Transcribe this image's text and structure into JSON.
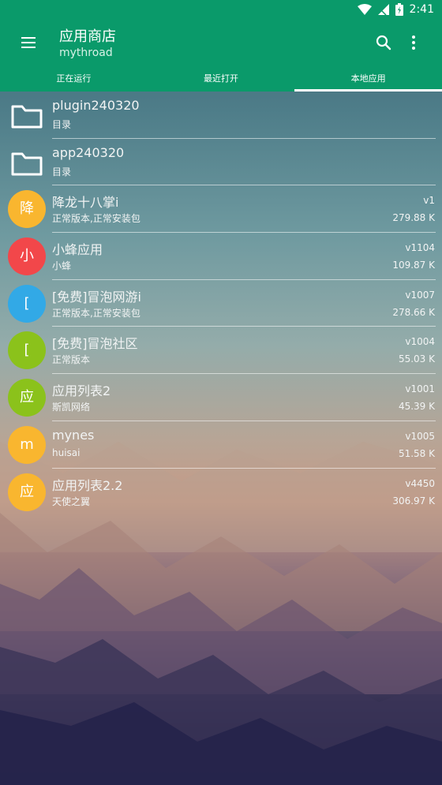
{
  "status_bar": {
    "time": "2:41"
  },
  "header": {
    "title": "应用商店",
    "subtitle": "mythroad"
  },
  "tabs": [
    {
      "label": "正在运行",
      "active": false
    },
    {
      "label": "最近打开",
      "active": false
    },
    {
      "label": "本地应用",
      "active": true
    }
  ],
  "items": [
    {
      "type": "folder",
      "name": "plugin240320",
      "desc": "目录"
    },
    {
      "type": "folder",
      "name": "app240320",
      "desc": "目录"
    },
    {
      "type": "app",
      "avatar": "降",
      "color": "#f9b62f",
      "name": "降龙十八掌i",
      "desc": "正常版本,正常安装包",
      "version": "v1",
      "size": "279.88 K"
    },
    {
      "type": "app",
      "avatar": "小",
      "color": "#f2474a",
      "name": "小蜂应用",
      "desc": "小蜂",
      "version": "v1104",
      "size": "109.87 K"
    },
    {
      "type": "app",
      "avatar": "[",
      "color": "#32a9e6",
      "name": "[免费]冒泡网游i",
      "desc": "正常版本,正常安装包",
      "version": "v1007",
      "size": "278.66 K"
    },
    {
      "type": "app",
      "avatar": "[",
      "color": "#8bc21b",
      "name": "[免费]冒泡社区",
      "desc": "正常版本",
      "version": "v1004",
      "size": "55.03 K"
    },
    {
      "type": "app",
      "avatar": "应",
      "color": "#8bc21b",
      "name": "应用列表2",
      "desc": "斯凯网络",
      "version": "v1001",
      "size": "45.39 K"
    },
    {
      "type": "app",
      "avatar": "m",
      "color": "#f9b62f",
      "name": "mynes",
      "desc": "huisai",
      "version": "v1005",
      "size": "51.58 K"
    },
    {
      "type": "app",
      "avatar": "应",
      "color": "#f9b62f",
      "name": "应用列表2.2",
      "desc": "天使之翼",
      "version": "v4450",
      "size": "306.97 K"
    }
  ]
}
